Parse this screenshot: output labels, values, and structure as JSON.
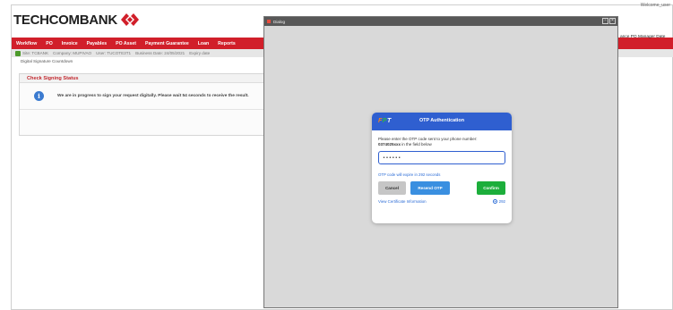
{
  "app": {
    "brand": "TECHCOMBANK",
    "top_right_text": "Welcome_user",
    "brand_colors": {
      "red": "#d11f2a",
      "otp_blue": "#2f5fd0",
      "confirm_green": "#1cae3b"
    }
  },
  "menu": {
    "items": [
      "Workflow",
      "PO",
      "Invoice",
      "Payables",
      "PO Asset",
      "Payment Guarantee",
      "Loan",
      "Reports"
    ],
    "right_text": "ance  PO Manager  Date"
  },
  "infobar": {
    "items": [
      "Site: TCBANK",
      "Company: MUPIVAO",
      "User: TUCOTE3T1",
      "Business Date: 24/05/2021",
      "Expiry date"
    ]
  },
  "breadcrumb": "Digital Signature Countdown",
  "panel": {
    "title": "Check Signing Status",
    "message": "We are in progress to sign your request digitally. Please wait 54 seconds to receive the result."
  },
  "dialog": {
    "title": "Dialog",
    "controls": [
      "restore-icon",
      "close-icon"
    ]
  },
  "otp": {
    "logo_letters": [
      "F",
      "P",
      "T"
    ],
    "title": "OTP Authentication",
    "instruction": "Please enter the OTP code sent to your phone number:",
    "phone": "0374025xxx",
    "instruction_tail": " in the field below",
    "input_value": "••••••",
    "expire_text": "OTP code will expire in 292 seconds",
    "cancel_label": "Cancel",
    "resend_label": "Resend OTP",
    "confirm_label": "Confirm",
    "view_cert_label": "View Certificate Information",
    "countdown": "292"
  }
}
